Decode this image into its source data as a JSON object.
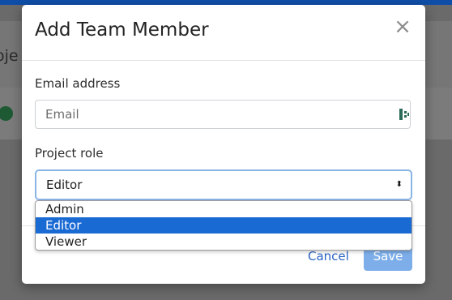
{
  "background": {
    "partial_text": "oje"
  },
  "modal": {
    "title": "Add Team Member",
    "close_symbol": "×",
    "email": {
      "label": "Email address",
      "placeholder": "Email",
      "value": ""
    },
    "role": {
      "label": "Project role",
      "selected": "Editor",
      "options": [
        "Admin",
        "Editor",
        "Viewer"
      ]
    },
    "buttons": {
      "cancel": "Cancel",
      "save": "Save"
    }
  },
  "icons": {
    "close": "close-icon",
    "password_manager": "password-manager-icon",
    "select_arrow": "select-arrow-icon",
    "user": "user-icon"
  },
  "colors": {
    "accent": "#1a6ad4",
    "link": "#2a64c3",
    "save_disabled": "#7daeea",
    "topbar": "#0f4ea8"
  }
}
